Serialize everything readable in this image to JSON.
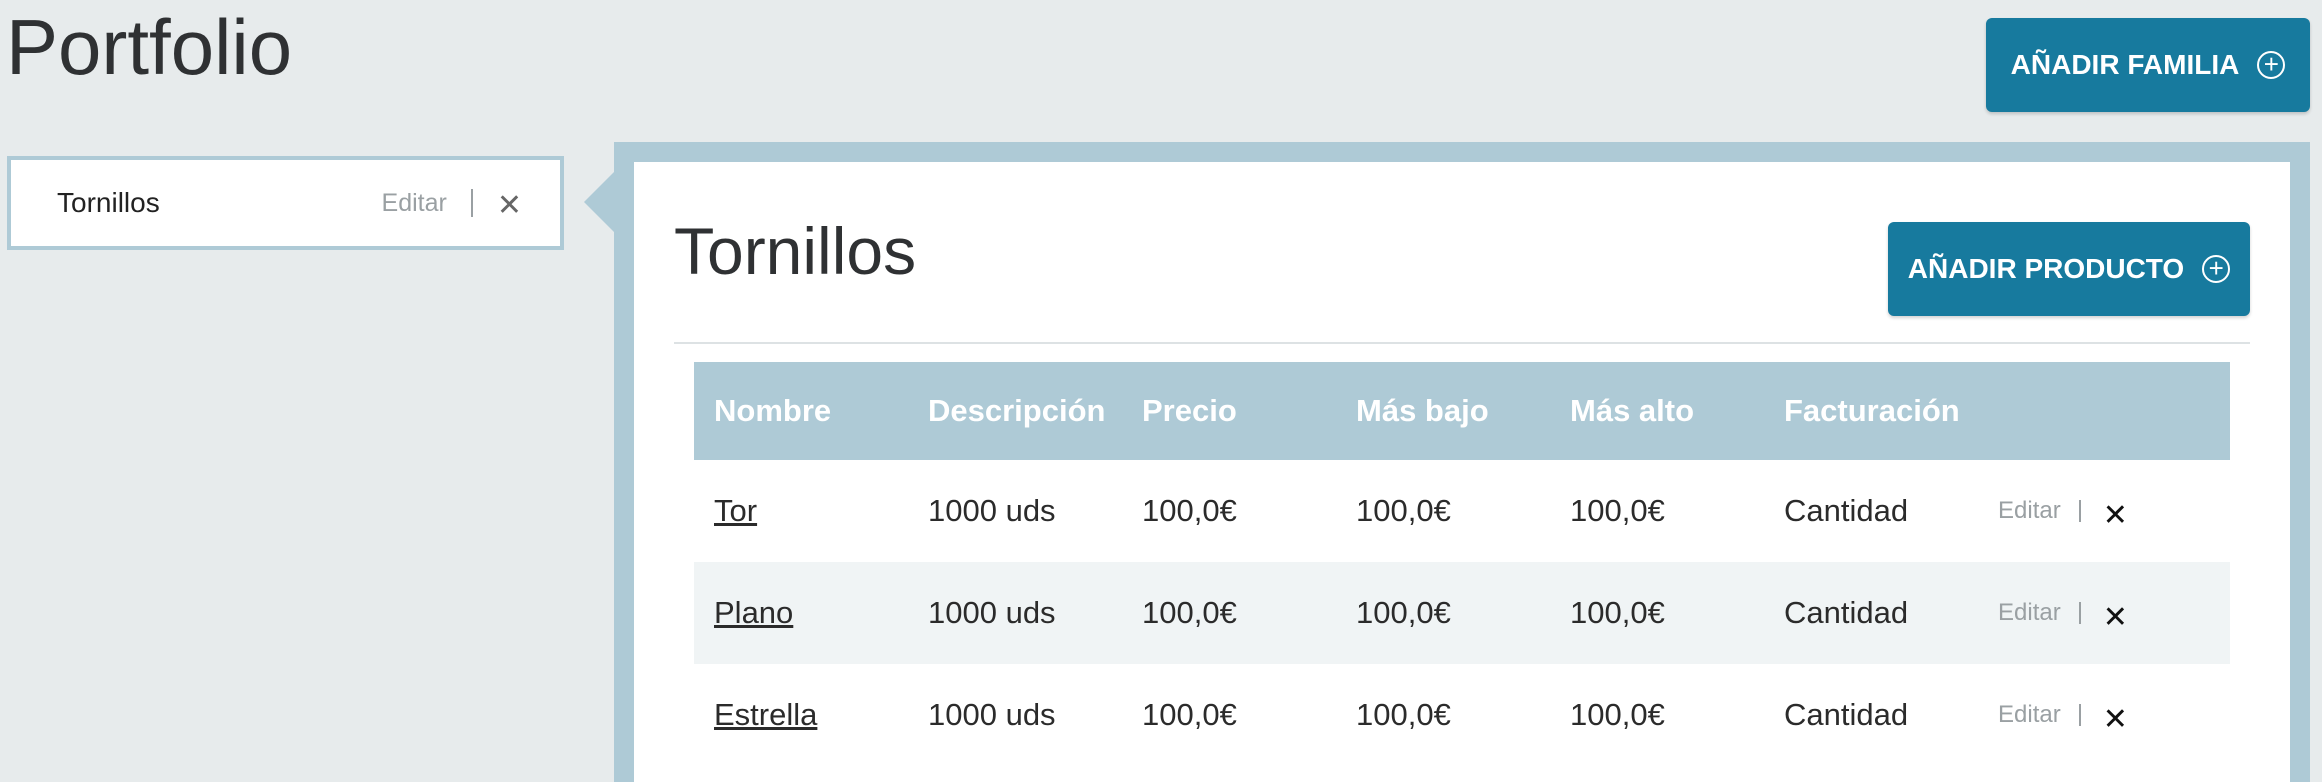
{
  "header": {
    "title": "Portfolio",
    "add_family_label": "AÑADIR FAMILIA",
    "add_family_icon": "plus-circle-icon"
  },
  "sidebar": {
    "families": [
      {
        "name": "Tornillos",
        "edit_label": "Editar",
        "delete_icon": "close-icon"
      }
    ]
  },
  "main": {
    "family_title": "Tornillos",
    "add_product_label": "AÑADIR PRODUCTO",
    "add_product_icon": "plus-circle-icon",
    "table": {
      "columns": [
        "Nombre",
        "Descripción",
        "Precio",
        "Más bajo",
        "Más alto",
        "Facturación"
      ],
      "rows": [
        {
          "name": "Tor",
          "description": "1000 uds",
          "price": "100,0€",
          "low": "100,0€",
          "high": "100,0€",
          "billing": "Cantidad",
          "edit_label": "Editar"
        },
        {
          "name": "Plano",
          "description": "1000 uds",
          "price": "100,0€",
          "low": "100,0€",
          "high": "100,0€",
          "billing": "Cantidad",
          "edit_label": "Editar"
        },
        {
          "name": "Estrella",
          "description": "1000 uds",
          "price": "100,0€",
          "low": "100,0€",
          "high": "100,0€",
          "billing": "Cantidad",
          "edit_label": "Editar"
        }
      ]
    }
  },
  "colors": {
    "accent": "#177a9e",
    "panel_border": "#aecad6",
    "background": "#e7ebec",
    "alt_row": "#f0f4f5"
  }
}
